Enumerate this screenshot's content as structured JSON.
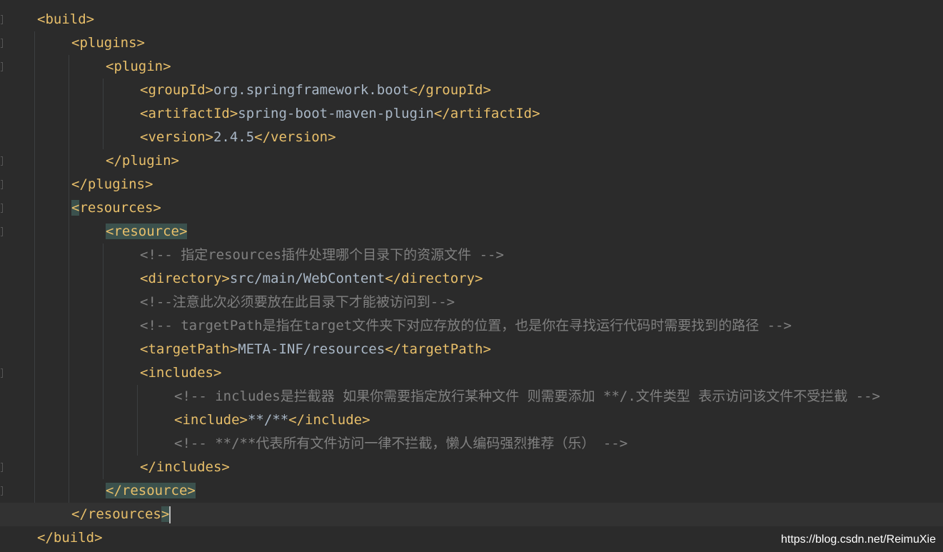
{
  "editor": {
    "lines": [
      {
        "parts": [
          {
            "t": "tag",
            "v": "<build>"
          }
        ]
      },
      {
        "parts": [
          {
            "t": "tag",
            "v": "<plugins>"
          }
        ]
      },
      {
        "parts": [
          {
            "t": "tag",
            "v": "<plugin>"
          }
        ]
      },
      {
        "parts": [
          {
            "t": "tag",
            "v": "<groupId>"
          },
          {
            "t": "txt",
            "v": "org.springframework.boot"
          },
          {
            "t": "tag",
            "v": "</groupId>"
          }
        ]
      },
      {
        "parts": [
          {
            "t": "tag",
            "v": "<artifactId>"
          },
          {
            "t": "txt",
            "v": "spring-boot-maven-plugin"
          },
          {
            "t": "tag",
            "v": "</artifactId>"
          }
        ]
      },
      {
        "parts": [
          {
            "t": "tag",
            "v": "<version>"
          },
          {
            "t": "txt",
            "v": "2.4.5"
          },
          {
            "t": "tag",
            "v": "</version>"
          }
        ]
      },
      {
        "parts": [
          {
            "t": "tag",
            "v": "</plugin>"
          }
        ]
      },
      {
        "parts": [
          {
            "t": "tag",
            "v": "</plugins>"
          }
        ]
      },
      {
        "parts": [
          {
            "t": "tag hl",
            "v": "<"
          },
          {
            "t": "tag",
            "v": "resources>"
          }
        ]
      },
      {
        "parts": [
          {
            "t": "tag hl",
            "v": "<resource>"
          }
        ]
      },
      {
        "parts": [
          {
            "t": "cmt",
            "v": "<!-- 指定resources插件处理哪个目录下的资源文件 -->"
          }
        ]
      },
      {
        "parts": [
          {
            "t": "tag",
            "v": "<directory>"
          },
          {
            "t": "txt",
            "v": "src/main/WebContent"
          },
          {
            "t": "tag",
            "v": "</directory>"
          }
        ]
      },
      {
        "parts": [
          {
            "t": "cmt",
            "v": "<!--注意此次必须要放在此目录下才能被访问到-->"
          }
        ]
      },
      {
        "parts": [
          {
            "t": "cmt",
            "v": "<!-- targetPath是指在target文件夹下对应存放的位置，也是你在寻找运行代码时需要找到的路径 -->"
          }
        ]
      },
      {
        "parts": [
          {
            "t": "tag",
            "v": "<targetPath>"
          },
          {
            "t": "txt",
            "v": "META-INF/resources"
          },
          {
            "t": "tag",
            "v": "</targetPath>"
          }
        ]
      },
      {
        "parts": [
          {
            "t": "tag",
            "v": "<includes>"
          }
        ]
      },
      {
        "parts": [
          {
            "t": "cmt",
            "v": "<!-- includes是拦截器 如果你需要指定放行某种文件 则需要添加 **/.文件类型 表示访问该文件不受拦截 -->"
          }
        ]
      },
      {
        "parts": [
          {
            "t": "tag",
            "v": "<include>"
          },
          {
            "t": "txt",
            "v": "**/**"
          },
          {
            "t": "tag",
            "v": "</include>"
          }
        ]
      },
      {
        "parts": [
          {
            "t": "cmt",
            "v": "<!-- **/**代表所有文件访问一律不拦截，懒人编码强烈推荐（乐） -->"
          }
        ]
      },
      {
        "parts": [
          {
            "t": "tag",
            "v": "</includes>"
          }
        ]
      },
      {
        "parts": [
          {
            "t": "tag hl",
            "v": "</resource>"
          }
        ]
      },
      {
        "parts": [
          {
            "t": "tag",
            "v": "</resources"
          },
          {
            "t": "tag hl",
            "v": ">"
          }
        ]
      },
      {
        "parts": [
          {
            "t": "tag",
            "v": "</build>"
          }
        ]
      }
    ]
  },
  "watermark": {
    "text": "https://blog.csdn.net/ReimuXie"
  }
}
